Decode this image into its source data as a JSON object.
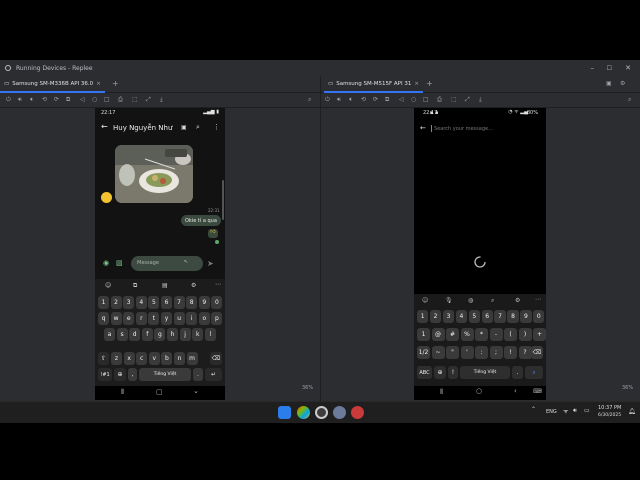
{
  "window": {
    "title": "Running Devices - Replee",
    "tab1_label": "Samsung SM-M336B API 36.0",
    "tab2_label": "Samsung SM-M515F API 31",
    "zoom_left": "36%",
    "zoom_right": "36%"
  },
  "phone1": {
    "status_time": "22:17",
    "contact_name": "Huy Nguyễn Như",
    "image_time": "22:31",
    "sent_message": "Okie tí a qua",
    "message_placeholder": "Message",
    "num_row": [
      "1",
      "2",
      "3",
      "4",
      "5",
      "6",
      "7",
      "8",
      "9",
      "0"
    ],
    "row1": [
      "q",
      "w",
      "e",
      "r",
      "t",
      "y",
      "u",
      "i",
      "o",
      "p"
    ],
    "row2": [
      "a",
      "s",
      "d",
      "f",
      "g",
      "h",
      "j",
      "k",
      "l"
    ],
    "row3": [
      "z",
      "x",
      "c",
      "v",
      "b",
      "n",
      "m"
    ],
    "sym_key": "!#1",
    "comma_key": ",",
    "space_label": "Tiếng Việt",
    "period_key": ".",
    "icons": {
      "back": "back-arrow-icon",
      "video": "video-call-icon",
      "search": "search-icon",
      "more": "more-vert-icon"
    }
  },
  "phone2": {
    "status_time": "22:17",
    "battery": "80%",
    "search_placeholder": "Search your message...",
    "row_num": [
      "1",
      "2",
      "3",
      "4",
      "5",
      "6",
      "7",
      "8",
      "9",
      "0"
    ],
    "row_sym1": [
      "1",
      "@",
      "#",
      "%",
      "*",
      "-",
      "(",
      ")"
    ],
    "row_sym1b": [
      "+"
    ],
    "row_sym2": [
      "1/2",
      "~",
      "\"",
      "'",
      ":",
      ";",
      "!",
      "?"
    ],
    "sym_key": "ABC",
    "excl_key": "!",
    "space_label": "Tiếng Việt",
    "period_key": "."
  },
  "taskbar": {
    "lang": "ENG",
    "time": "10:37 PM",
    "date": "6/30/2025"
  },
  "colors": {
    "accent": "#3574f0",
    "ide_bg": "#2b2d30",
    "bubble": "#3b4a3f",
    "input_bg": "#3d4a42"
  }
}
